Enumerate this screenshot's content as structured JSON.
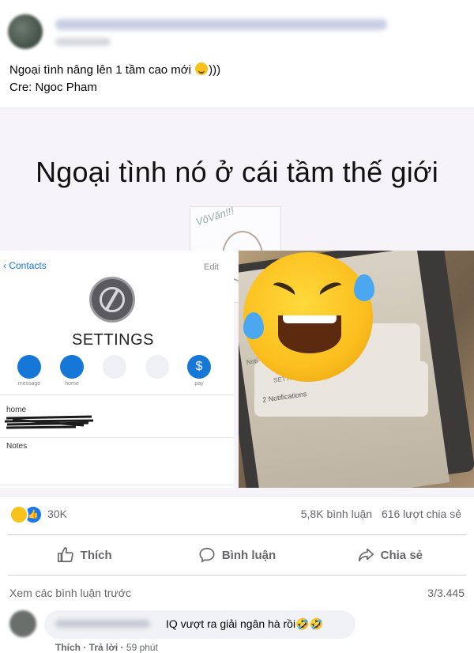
{
  "post": {
    "text_line1": "Ngoại tình nâng lên 1 tầm cao mới",
    "emoji": "smiling-face-icon",
    "text_suffix": ")))",
    "text_line2": "Cre: Ngoc Pham"
  },
  "meme": {
    "caption": "Ngoại tình nó ở cái tầm thế giới",
    "watermark": "VôVăn!!!",
    "left_screen": {
      "back_label": "Contacts",
      "edit_label": "Edit",
      "contact_name": "SETTINGS",
      "actions": [
        "message",
        "home",
        "",
        "",
        "pay"
      ],
      "home_label": "home",
      "notes_label": "Notes"
    },
    "right_screen": {
      "notif_app": "SETTINGS",
      "notif_body": "2 Notifications",
      "notif_partial": "Noti"
    }
  },
  "reactions": {
    "count": "30K",
    "comments": "5,8K bình luận",
    "shares": "616 lượt chia sẻ"
  },
  "actions": {
    "like": "Thích",
    "comment": "Bình luận",
    "share": "Chia sẻ"
  },
  "comments": {
    "view_previous": "Xem các bình luận trước",
    "count": "3/3.445",
    "first": {
      "text": "IQ vượt ra giải ngân hà rồi🤣🤣",
      "like": "Thích",
      "reply": "Trả lời",
      "time": "59 phút"
    }
  },
  "colors": {
    "link_blue": "#1877f2",
    "muted": "#65676b",
    "bubble": "#f0f2f5"
  }
}
